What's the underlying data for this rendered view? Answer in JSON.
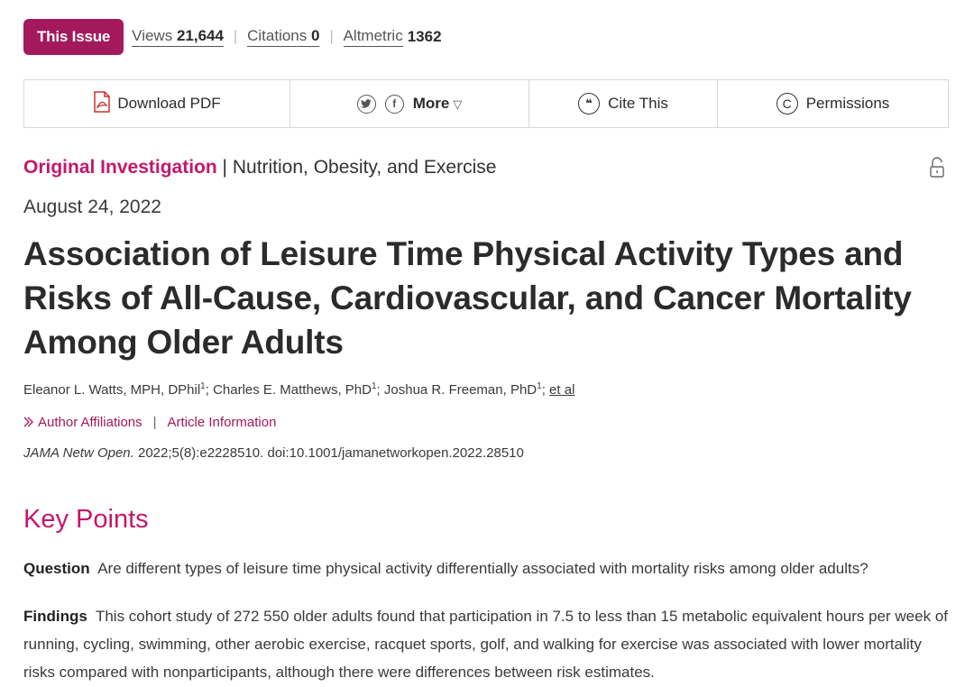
{
  "metrics": {
    "issue_label": "This Issue",
    "views_label": "Views",
    "views_value": "21,644",
    "citations_label": "Citations",
    "citations_value": "0",
    "altmetric_label": "Altmetric",
    "altmetric_value": "1362"
  },
  "toolbar": {
    "download_label": "Download PDF",
    "more_label": "More",
    "cite_label": "Cite This",
    "permissions_label": "Permissions"
  },
  "article": {
    "type": "Original Investigation",
    "topic": "Nutrition, Obesity, and Exercise",
    "date": "August 24, 2022",
    "title": "Association of Leisure Time Physical Activity Types and Risks of All-Cause, Cardiovascular, and Cancer Mortality Among Older Adults",
    "authors": [
      {
        "name": "Eleanor L. Watts, MPH, DPhil",
        "sup": "1"
      },
      {
        "name": "Charles E. Matthews, PhD",
        "sup": "1"
      },
      {
        "name": "Joshua R. Freeman, PhD",
        "sup": "1"
      }
    ],
    "et_al": "et al",
    "affiliations_label": "Author Affiliations",
    "article_info_label": "Article Information",
    "journal": "JAMA Netw Open.",
    "citation_rest": " 2022;5(8):e2228510. doi:10.1001/jamanetworkopen.2022.28510"
  },
  "key_points": {
    "title": "Key Points",
    "question_label": "Question",
    "question_text": "Are different types of leisure time physical activity differentially associated with mortality risks among older adults?",
    "findings_label": "Findings",
    "findings_text": "This cohort study of 272 550 older adults found that participation in 7.5 to less than 15 metabolic equivalent hours per week of running, cycling, swimming, other aerobic exercise, racquet sports, golf, and walking for exercise was associated with lower mortality risks compared with nonparticipants, although there were differences between risk estimates."
  },
  "colors": {
    "brand": "#a3195b",
    "accent": "#c4186c",
    "text": "#2b2b2b"
  },
  "icons": [
    "pdf-icon",
    "twitter-icon",
    "facebook-icon",
    "caret-down-icon",
    "quote-icon",
    "copyright-icon",
    "lock-open-icon",
    "chevron-right-icon"
  ]
}
